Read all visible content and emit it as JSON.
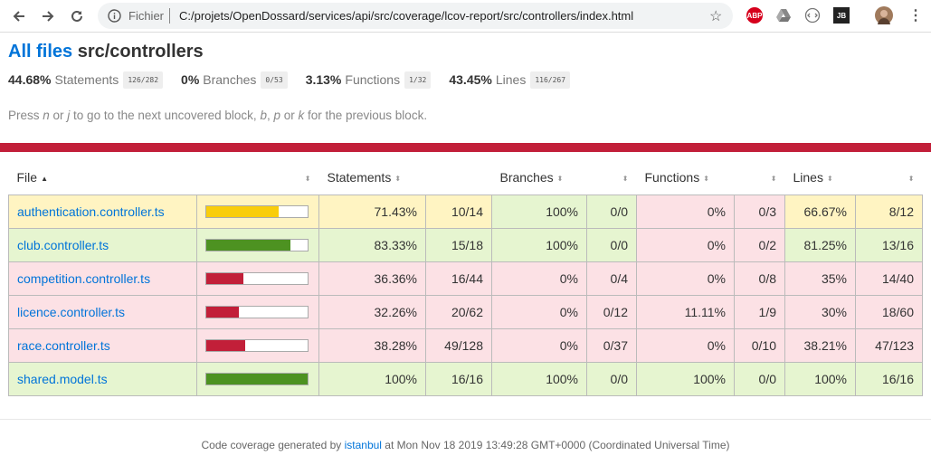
{
  "browser": {
    "scheme_label": "Fichier",
    "url": "C:/projets/OpenDossard/services/api/src/coverage/lcov-report/src/controllers/index.html",
    "extensions": [
      "ABP",
      "drive-icon",
      "dev-icon",
      "JB"
    ]
  },
  "header": {
    "all_files_link": "All files",
    "path": "src/controllers"
  },
  "summary": [
    {
      "pct": "44.68%",
      "name": "Statements",
      "frac": "126/282"
    },
    {
      "pct": "0%",
      "name": "Branches",
      "frac": "0/53"
    },
    {
      "pct": "3.13%",
      "name": "Functions",
      "frac": "1/32"
    },
    {
      "pct": "43.45%",
      "name": "Lines",
      "frac": "116/267"
    }
  ],
  "hint": {
    "p1": "Press ",
    "k1": "n",
    "p2": " or ",
    "k2": "j",
    "p3": " to go to the next uncovered block, ",
    "k3": "b",
    "p4": ", ",
    "k4": "p",
    "p5": " or ",
    "k5": "k",
    "p6": " for the previous block."
  },
  "table": {
    "headers": {
      "file": "File",
      "statements": "Statements",
      "branches": "Branches",
      "functions": "Functions",
      "lines": "Lines"
    },
    "rows": [
      {
        "file": "authentication.controller.ts",
        "level": "medium",
        "bar_pct": 71.43,
        "stmt_pct": "71.43%",
        "stmt_frac": "10/14",
        "branch_pct": "100%",
        "branch_frac": "0/0",
        "branch_level": "high",
        "func_pct": "0%",
        "func_frac": "0/3",
        "func_level": "low",
        "lines_pct": "66.67%",
        "lines_frac": "8/12",
        "lines_level": "medium"
      },
      {
        "file": "club.controller.ts",
        "level": "high",
        "bar_pct": 83.33,
        "stmt_pct": "83.33%",
        "stmt_frac": "15/18",
        "branch_pct": "100%",
        "branch_frac": "0/0",
        "branch_level": "high",
        "func_pct": "0%",
        "func_frac": "0/2",
        "func_level": "low",
        "lines_pct": "81.25%",
        "lines_frac": "13/16",
        "lines_level": "high"
      },
      {
        "file": "competition.controller.ts",
        "level": "low",
        "bar_pct": 36.36,
        "stmt_pct": "36.36%",
        "stmt_frac": "16/44",
        "branch_pct": "0%",
        "branch_frac": "0/4",
        "branch_level": "low",
        "func_pct": "0%",
        "func_frac": "0/8",
        "func_level": "low",
        "lines_pct": "35%",
        "lines_frac": "14/40",
        "lines_level": "low"
      },
      {
        "file": "licence.controller.ts",
        "level": "low",
        "bar_pct": 32.26,
        "stmt_pct": "32.26%",
        "stmt_frac": "20/62",
        "branch_pct": "0%",
        "branch_frac": "0/12",
        "branch_level": "low",
        "func_pct": "11.11%",
        "func_frac": "1/9",
        "func_level": "low",
        "lines_pct": "30%",
        "lines_frac": "18/60",
        "lines_level": "low"
      },
      {
        "file": "race.controller.ts",
        "level": "low",
        "bar_pct": 38.28,
        "stmt_pct": "38.28%",
        "stmt_frac": "49/128",
        "branch_pct": "0%",
        "branch_frac": "0/37",
        "branch_level": "low",
        "func_pct": "0%",
        "func_frac": "0/10",
        "func_level": "low",
        "lines_pct": "38.21%",
        "lines_frac": "47/123",
        "lines_level": "low"
      },
      {
        "file": "shared.model.ts",
        "level": "high",
        "bar_pct": 100,
        "stmt_pct": "100%",
        "stmt_frac": "16/16",
        "branch_pct": "100%",
        "branch_frac": "0/0",
        "branch_level": "high",
        "func_pct": "100%",
        "func_frac": "0/0",
        "func_level": "high",
        "lines_pct": "100%",
        "lines_frac": "16/16",
        "lines_level": "high"
      }
    ]
  },
  "footer": {
    "prefix": "Code coverage generated by ",
    "link": "istanbul",
    "suffix": " at Mon Nov 18 2019 13:49:28 GMT+0000 (Coordinated Universal Time)"
  },
  "colors": {
    "high": "#4d9221",
    "medium": "#f9cd0b",
    "low": "#c21f39",
    "link": "#0074d9"
  }
}
